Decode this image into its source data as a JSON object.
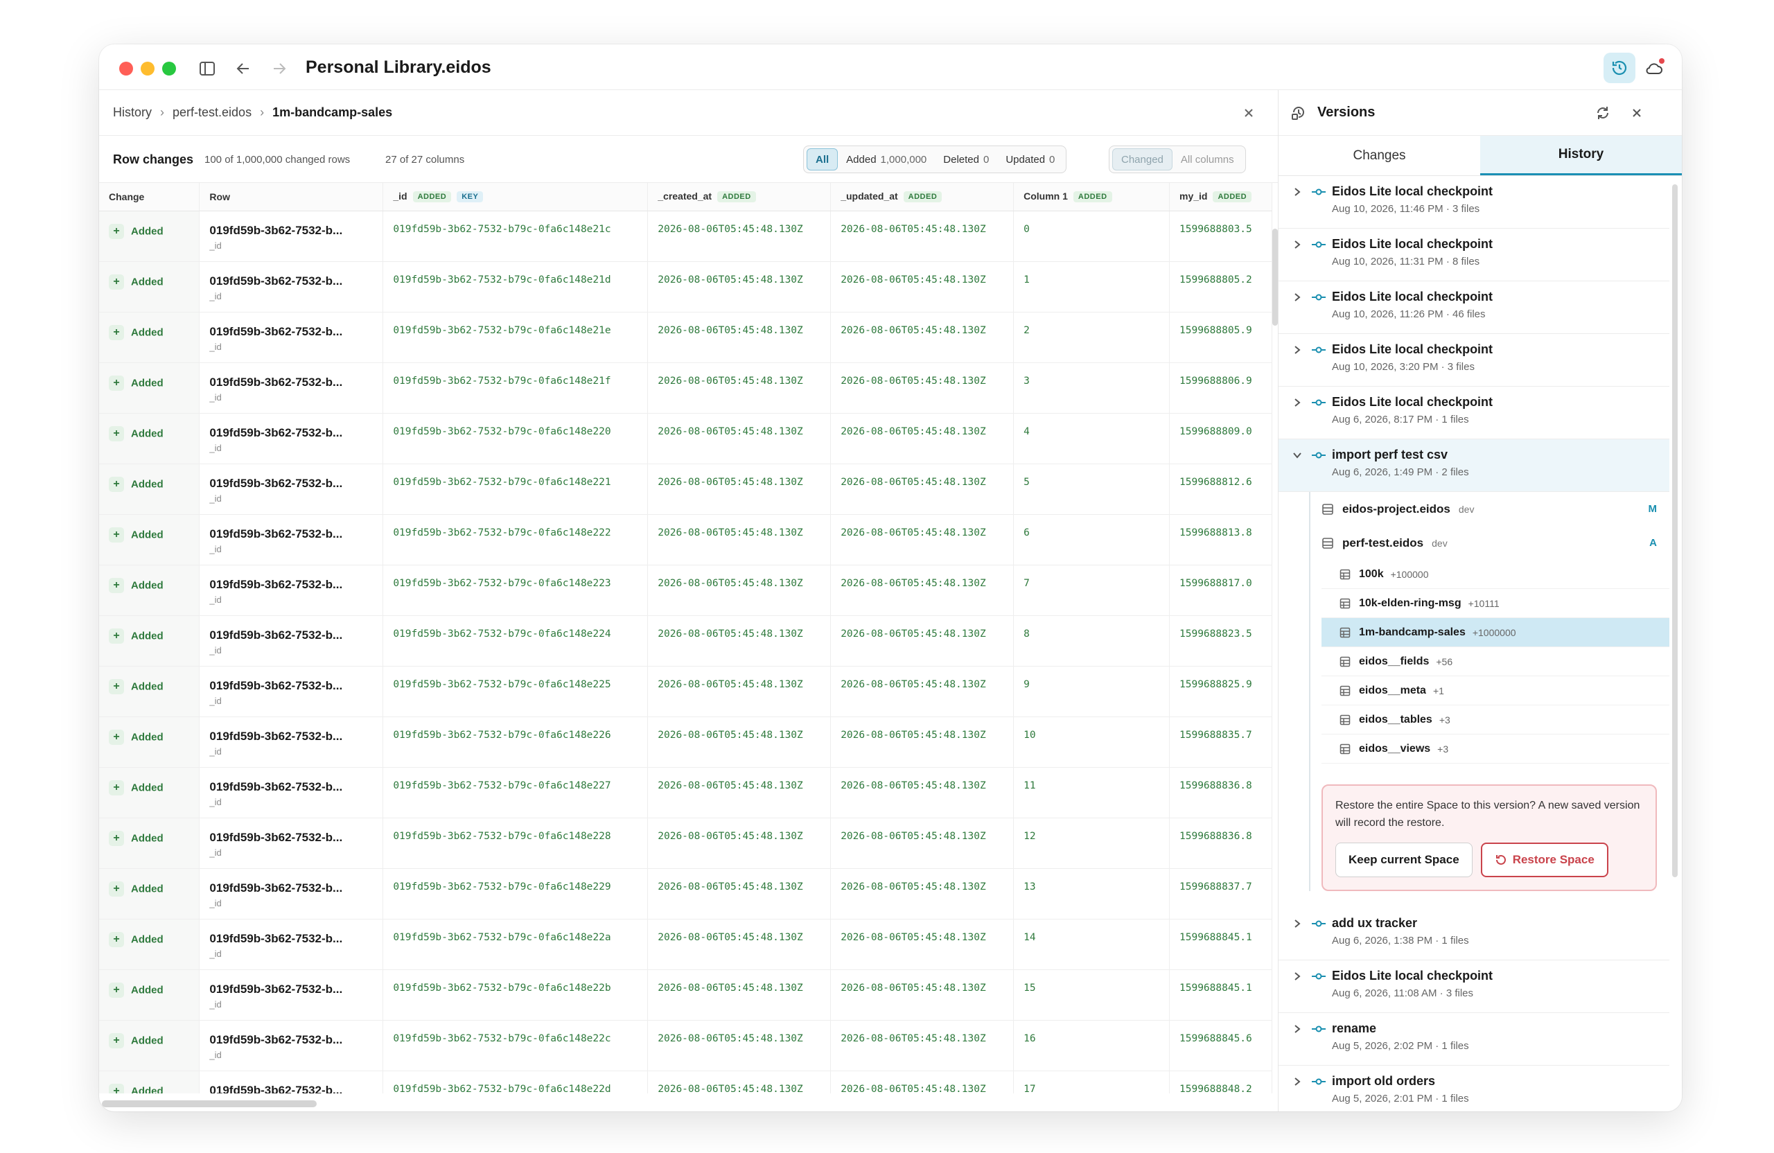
{
  "window": {
    "title": "Personal Library.eidos"
  },
  "breadcrumb": {
    "items": [
      "History",
      "perf-test.eidos",
      "1m-bandcamp-sales"
    ]
  },
  "toolbar": {
    "title": "Row changes",
    "rows_info": "100 of 1,000,000 changed rows",
    "cols_info": "27 of 27 columns",
    "filters": [
      {
        "label": "All",
        "count": ""
      },
      {
        "label": "Added",
        "count": "1,000,000"
      },
      {
        "label": "Deleted",
        "count": "0"
      },
      {
        "label": "Updated",
        "count": "0"
      }
    ],
    "column_modes": [
      "Changed",
      "All columns"
    ]
  },
  "table": {
    "columns": [
      {
        "label": "Change",
        "tags": []
      },
      {
        "label": "Row",
        "tags": []
      },
      {
        "label": "_id",
        "tags": [
          "ADDED",
          "KEY"
        ]
      },
      {
        "label": "_created_at",
        "tags": [
          "ADDED"
        ]
      },
      {
        "label": "_updated_at",
        "tags": [
          "ADDED"
        ]
      },
      {
        "label": "Column 1",
        "tags": [
          "ADDED"
        ]
      },
      {
        "label": "my_id",
        "tags": [
          "ADDED"
        ]
      }
    ],
    "change_label": "Added",
    "row_title": "019fd59b-3b62-7532-b...",
    "row_sub": "_id",
    "timestamp": "2026-08-06T05:45:48.130Z",
    "rows": [
      {
        "id": "019fd59b-3b62-7532-b79c-0fa6c148e21c",
        "col1": "0",
        "my_id": "1599688803.5"
      },
      {
        "id": "019fd59b-3b62-7532-b79c-0fa6c148e21d",
        "col1": "1",
        "my_id": "1599688805.2"
      },
      {
        "id": "019fd59b-3b62-7532-b79c-0fa6c148e21e",
        "col1": "2",
        "my_id": "1599688805.9"
      },
      {
        "id": "019fd59b-3b62-7532-b79c-0fa6c148e21f",
        "col1": "3",
        "my_id": "1599688806.9"
      },
      {
        "id": "019fd59b-3b62-7532-b79c-0fa6c148e220",
        "col1": "4",
        "my_id": "1599688809.0"
      },
      {
        "id": "019fd59b-3b62-7532-b79c-0fa6c148e221",
        "col1": "5",
        "my_id": "1599688812.6"
      },
      {
        "id": "019fd59b-3b62-7532-b79c-0fa6c148e222",
        "col1": "6",
        "my_id": "1599688813.8"
      },
      {
        "id": "019fd59b-3b62-7532-b79c-0fa6c148e223",
        "col1": "7",
        "my_id": "1599688817.0"
      },
      {
        "id": "019fd59b-3b62-7532-b79c-0fa6c148e224",
        "col1": "8",
        "my_id": "1599688823.5"
      },
      {
        "id": "019fd59b-3b62-7532-b79c-0fa6c148e225",
        "col1": "9",
        "my_id": "1599688825.9"
      },
      {
        "id": "019fd59b-3b62-7532-b79c-0fa6c148e226",
        "col1": "10",
        "my_id": "1599688835.7"
      },
      {
        "id": "019fd59b-3b62-7532-b79c-0fa6c148e227",
        "col1": "11",
        "my_id": "1599688836.8"
      },
      {
        "id": "019fd59b-3b62-7532-b79c-0fa6c148e228",
        "col1": "12",
        "my_id": "1599688836.8"
      },
      {
        "id": "019fd59b-3b62-7532-b79c-0fa6c148e229",
        "col1": "13",
        "my_id": "1599688837.7"
      },
      {
        "id": "019fd59b-3b62-7532-b79c-0fa6c148e22a",
        "col1": "14",
        "my_id": "1599688845.1"
      },
      {
        "id": "019fd59b-3b62-7532-b79c-0fa6c148e22b",
        "col1": "15",
        "my_id": "1599688845.1"
      },
      {
        "id": "019fd59b-3b62-7532-b79c-0fa6c148e22c",
        "col1": "16",
        "my_id": "1599688845.6"
      },
      {
        "id": "019fd59b-3b62-7532-b79c-0fa6c148e22d",
        "col1": "17",
        "my_id": "1599688848.2"
      }
    ]
  },
  "panel": {
    "title": "Versions",
    "tabs": [
      "Changes",
      "History"
    ],
    "versions_top": [
      {
        "title": "Eidos Lite local checkpoint",
        "sub": "Aug 10, 2026, 11:46 PM · 3 files"
      },
      {
        "title": "Eidos Lite local checkpoint",
        "sub": "Aug 10, 2026, 11:31 PM · 8 files"
      },
      {
        "title": "Eidos Lite local checkpoint",
        "sub": "Aug 10, 2026, 11:26 PM · 46 files"
      },
      {
        "title": "Eidos Lite local checkpoint",
        "sub": "Aug 10, 2026, 3:20 PM · 3 files"
      },
      {
        "title": "Eidos Lite local checkpoint",
        "sub": "Aug 6, 2026, 8:17 PM · 1 files"
      }
    ],
    "open_version": {
      "title": "import perf test csv",
      "sub": "Aug 6, 2026, 1:49 PM · 2 files"
    },
    "files": [
      {
        "name": "eidos-project.eidos",
        "env": "dev",
        "status": "M"
      },
      {
        "name": "perf-test.eidos",
        "env": "dev",
        "status": "A"
      }
    ],
    "tables": [
      {
        "name": "100k",
        "count": "+100000"
      },
      {
        "name": "10k-elden-ring-msg",
        "count": "+10111"
      },
      {
        "name": "1m-bandcamp-sales",
        "count": "+1000000"
      },
      {
        "name": "eidos__fields",
        "count": "+56"
      },
      {
        "name": "eidos__meta",
        "count": "+1"
      },
      {
        "name": "eidos__tables",
        "count": "+3"
      },
      {
        "name": "eidos__views",
        "count": "+3"
      }
    ],
    "restore": {
      "message": "Restore the entire Space to this version? A new saved version will record the restore.",
      "keep_label": "Keep current Space",
      "restore_label": "Restore Space"
    },
    "versions_bottom": [
      {
        "title": "add ux tracker",
        "sub": "Aug 6, 2026, 1:38 PM · 1 files"
      },
      {
        "title": "Eidos Lite local checkpoint",
        "sub": "Aug 6, 2026, 11:08 AM · 3 files"
      },
      {
        "title": "rename",
        "sub": "Aug 5, 2026, 2:02 PM · 1 files"
      },
      {
        "title": "import old orders",
        "sub": "Aug 5, 2026, 2:01 PM · 1 files"
      }
    ]
  }
}
